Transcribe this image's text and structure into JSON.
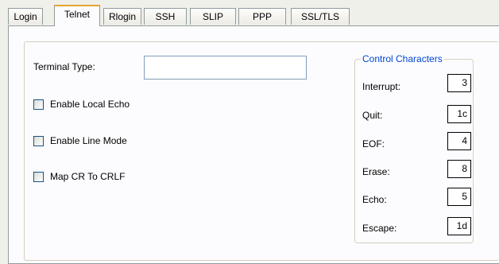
{
  "tabs": [
    {
      "label": "Login"
    },
    {
      "label": "Telnet"
    },
    {
      "label": "Rlogin"
    },
    {
      "label": "SSH"
    },
    {
      "label": "SLIP"
    },
    {
      "label": "PPP"
    },
    {
      "label": "SSL/TLS"
    }
  ],
  "active_tab": "Telnet",
  "terminal_type": {
    "label": "Terminal Type:",
    "value": ""
  },
  "options": [
    {
      "label": "Enable Local Echo",
      "checked": false
    },
    {
      "label": "Enable Line Mode",
      "checked": false
    },
    {
      "label": "Map CR To CRLF",
      "checked": false
    }
  ],
  "control_characters": {
    "title": "Control Characters",
    "items": [
      {
        "label": "Interrupt:",
        "value": "3"
      },
      {
        "label": "Quit:",
        "value": "1c"
      },
      {
        "label": "EOF:",
        "value": "4"
      },
      {
        "label": "Erase:",
        "value": "8"
      },
      {
        "label": "Echo:",
        "value": "5"
      },
      {
        "label": "Escape:",
        "value": "1d"
      }
    ]
  },
  "colors": {
    "accent": "#0046d5",
    "tab_highlight": "#ffc83c"
  }
}
